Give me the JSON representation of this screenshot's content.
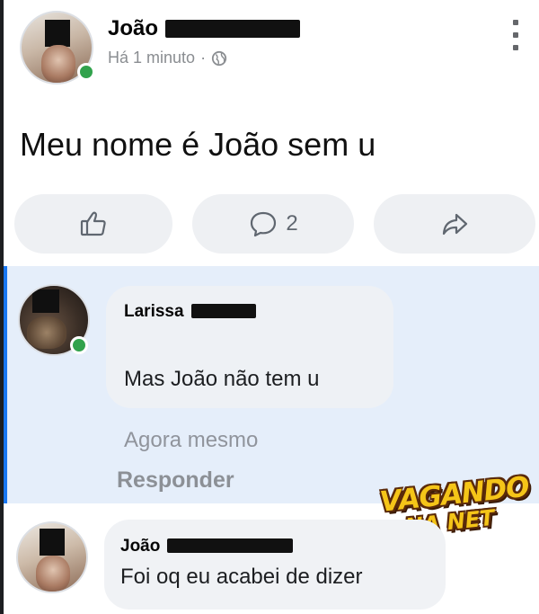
{
  "post": {
    "author": "João",
    "timestamp": "Há 1 minuto",
    "separator": "·",
    "privacy_icon": "globe-icon",
    "text": "Meu nome é João sem u",
    "more_icon": "kebab-menu-icon"
  },
  "actions": {
    "like_icon": "thumbs-up-icon",
    "comment_icon": "comment-bubble-icon",
    "comment_count": "2",
    "share_icon": "share-arrow-icon"
  },
  "comments": [
    {
      "author": "Larissa",
      "text": "Mas João não tem u",
      "time": "Agora mesmo",
      "reply_label": "Responder",
      "online": true
    },
    {
      "author": "João",
      "text": "Foi oq eu acabei de dizer"
    }
  ],
  "watermark": {
    "line1": "VAGANDO",
    "line2": "NA NET"
  },
  "colors": {
    "highlight_bg": "#e5eefa",
    "accent": "#1877f2",
    "online": "#31a24c",
    "watermark_fill": "#f5c518"
  }
}
